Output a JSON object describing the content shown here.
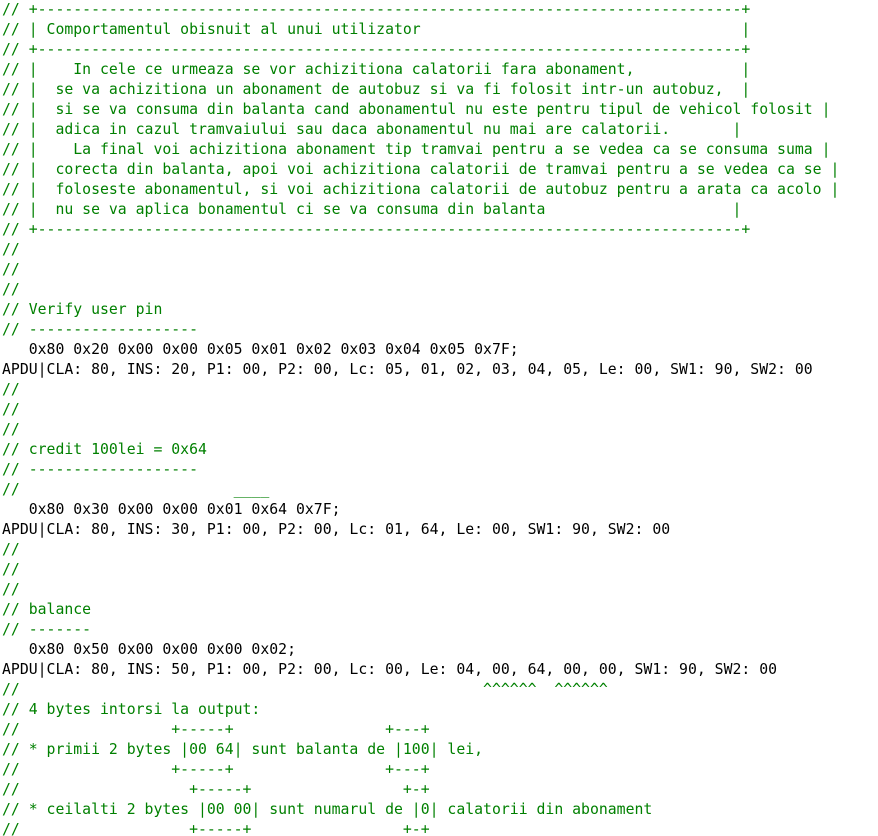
{
  "colors": {
    "comment": "#008000",
    "code": "#000000",
    "background": "#ffffff"
  },
  "lines": [
    {
      "kind": "comment",
      "text": "// +-------------------------------------------------------------------------------+"
    },
    {
      "kind": "comment",
      "text": "// | Comportamentul obisnuit al unui utilizator                                    |"
    },
    {
      "kind": "comment",
      "text": "// +-------------------------------------------------------------------------------+"
    },
    {
      "kind": "comment",
      "text": "// |    In cele ce urmeaza se vor achizitiona calatorii fara abonament,            |"
    },
    {
      "kind": "comment",
      "text": "// |  se va achizitiona un abonament de autobuz si va fi folosit intr-un autobuz,  |"
    },
    {
      "kind": "comment",
      "text": "// |  si se va consuma din balanta cand abonamentul nu este pentru tipul de vehicol folosit |"
    },
    {
      "kind": "comment",
      "text": "// |  adica in cazul tramvaiului sau daca abonamentul nu mai are calatorii.       |"
    },
    {
      "kind": "comment",
      "text": "// |    La final voi achizitiona abonament tip tramvai pentru a se vedea ca se consuma suma |"
    },
    {
      "kind": "comment",
      "text": "// |  corecta din balanta, apoi voi achizitiona calatorii de tramvai pentru a se vedea ca se |"
    },
    {
      "kind": "comment",
      "text": "// |  foloseste abonamentul, si voi achizitiona calatorii de autobuz pentru a arata ca acolo |"
    },
    {
      "kind": "comment",
      "text": "// |  nu se va aplica bonamentul ci se va consuma din balanta                     |"
    },
    {
      "kind": "comment",
      "text": "// +-------------------------------------------------------------------------------+"
    },
    {
      "kind": "comment",
      "text": "//"
    },
    {
      "kind": "comment",
      "text": "//"
    },
    {
      "kind": "comment",
      "text": "//"
    },
    {
      "kind": "comment",
      "text": "// Verify user pin"
    },
    {
      "kind": "comment",
      "text": "// -------------------"
    },
    {
      "kind": "code",
      "text": "   0x80 0x20 0x00 0x00 0x05 0x01 0x02 0x03 0x04 0x05 0x7F;"
    },
    {
      "kind": "output",
      "text": "APDU|CLA: 80, INS: 20, P1: 00, P2: 00, Lc: 05, 01, 02, 03, 04, 05, Le: 00, SW1: 90, SW2: 00"
    },
    {
      "kind": "comment",
      "text": "//"
    },
    {
      "kind": "comment",
      "text": "//"
    },
    {
      "kind": "comment",
      "text": "//"
    },
    {
      "kind": "comment",
      "text": "// credit 100lei = 0x64"
    },
    {
      "kind": "comment",
      "text": "// -------------------"
    },
    {
      "kind": "comment",
      "text": "//                        ____"
    },
    {
      "kind": "code",
      "text": "   0x80 0x30 0x00 0x00 0x01 0x64 0x7F;"
    },
    {
      "kind": "output",
      "text": "APDU|CLA: 80, INS: 30, P1: 00, P2: 00, Lc: 01, 64, Le: 00, SW1: 90, SW2: 00"
    },
    {
      "kind": "comment",
      "text": "//"
    },
    {
      "kind": "comment",
      "text": "//"
    },
    {
      "kind": "comment",
      "text": "//"
    },
    {
      "kind": "comment",
      "text": "// balance"
    },
    {
      "kind": "comment",
      "text": "// -------"
    },
    {
      "kind": "code",
      "text": "   0x80 0x50 0x00 0x00 0x00 0x02;"
    },
    {
      "kind": "output",
      "text": "APDU|CLA: 80, INS: 50, P1: 00, P2: 00, Lc: 00, Le: 04, 00, 64, 00, 00, SW1: 90, SW2: 00"
    },
    {
      "kind": "comment",
      "text": "//                                                    ^^^^^^  ^^^^^^"
    },
    {
      "kind": "comment",
      "text": "// 4 bytes intorsi la output:"
    },
    {
      "kind": "comment",
      "text": "//                 +-----+                 +---+"
    },
    {
      "kind": "comment",
      "text": "// * primii 2 bytes |00 64| sunt balanta de |100| lei,"
    },
    {
      "kind": "comment",
      "text": "//                 +-----+                 +---+"
    },
    {
      "kind": "comment",
      "text": "//                   +-----+                 +-+"
    },
    {
      "kind": "comment",
      "text": "// * ceilalti 2 bytes |00 00| sunt numarul de |0| calatorii din abonament"
    },
    {
      "kind": "comment",
      "text": "//                   +-----+                 +-+"
    }
  ]
}
